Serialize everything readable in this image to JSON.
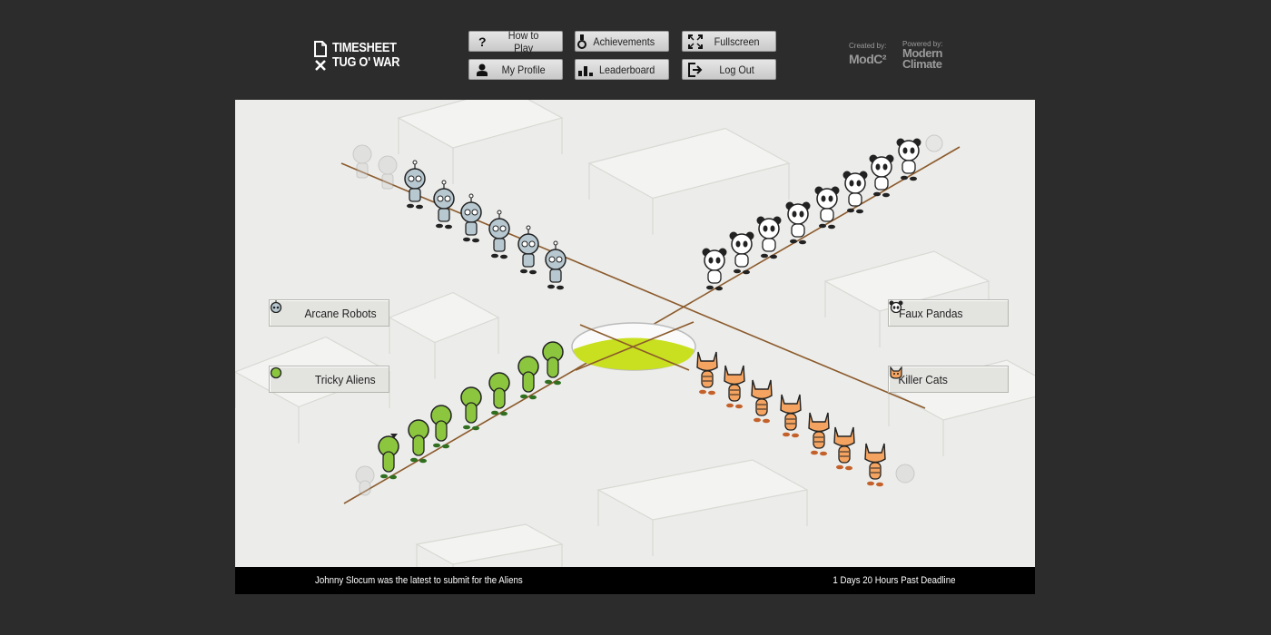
{
  "app": {
    "logo_line1": "TIMESHEET",
    "logo_line2": "TUG O' WAR"
  },
  "nav": [
    {
      "label": "How to Play",
      "icon": "question-icon"
    },
    {
      "label": "Achievements",
      "icon": "medal-icon"
    },
    {
      "label": "Fullscreen",
      "icon": "fullscreen-icon"
    },
    {
      "label": "My Profile",
      "icon": "user-icon"
    },
    {
      "label": "Leaderboard",
      "icon": "bar-chart-icon"
    },
    {
      "label": "Log Out",
      "icon": "logout-icon"
    }
  ],
  "credits": {
    "created_by_label": "Created by:",
    "created_by_name": "ModC²",
    "powered_by_label": "Powered by:",
    "powered_by_name_1": "Modern",
    "powered_by_name_2": "Climate"
  },
  "teams": [
    {
      "name": "Arcane Robots",
      "icon": "robot-icon",
      "color": "#b8c8d0"
    },
    {
      "name": "Faux Pandas",
      "icon": "panda-icon",
      "color": "#ffffff"
    },
    {
      "name": "Tricky Aliens",
      "icon": "alien-icon",
      "color": "#8cc63f"
    },
    {
      "name": "Killer Cats",
      "icon": "cat-icon",
      "color": "#f4a460"
    }
  ],
  "status": {
    "latest_submission": "Johnny Slocum was the latest to submit for the Aliens",
    "deadline": "1 Days 20 Hours Past Deadline"
  },
  "colors": {
    "background": "#2c2c2c",
    "stage": "#ececea",
    "goo": "#c8e020",
    "rope": "#8b5a2b"
  }
}
